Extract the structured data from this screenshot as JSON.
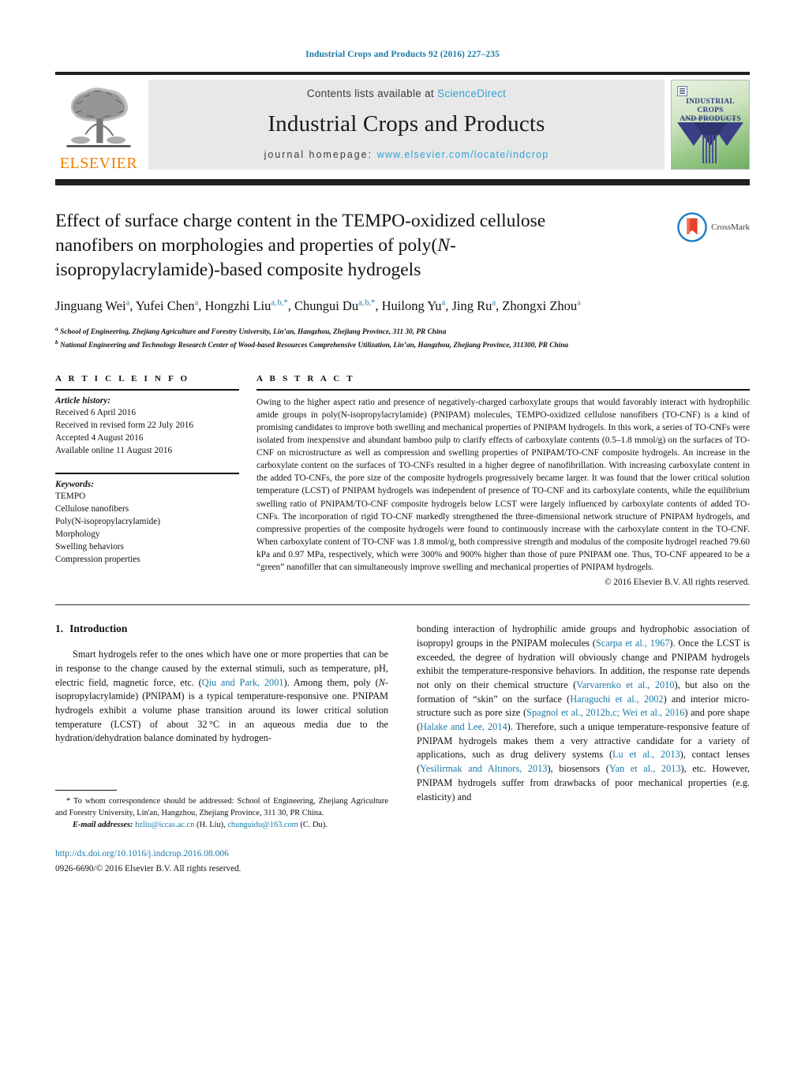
{
  "running_head": "Industrial Crops and Products 92 (2016) 227–235",
  "masthead": {
    "publisher_logo_text": "ELSEVIER",
    "contents_prefix": "Contents lists available at",
    "contents_link": "ScienceDirect",
    "journal_title": "Industrial Crops and Products",
    "homepage_prefix": "journal homepage:",
    "homepage_url": "www.elsevier.com/locate/indcrop",
    "cover_title_line1": "INDUSTRIAL CROPS",
    "cover_title_line2": "AND PRODUCTS",
    "cover_subtitle": "AN INTERNATIONAL JOURNAL"
  },
  "article": {
    "title_part1": "Effect of surface charge content in the TEMPO-oxidized cellulose nanofibers on morphologies and properties of poly(",
    "title_italic": "N",
    "title_part2": "-isopropylacrylamide)-based composite hydrogels",
    "crossmark_label": "CrossMark",
    "authors": "Jinguang Wei a, Yufei Chen a, Hongzhi Liu a, b,*, Chungui Du a, b,*, Huilong Yu a, Jing Ru a, Zhongxi Zhou a",
    "affiliation_a": "a School of Engineering, Zhejiang Agriculture and Forestry University, Lin'an, Hangzhou, Zhejiang Province, 311 30, PR China",
    "affiliation_b": "b National Engineering and Technology Research Center of Wood-based Resources Comprehensive Utilization, Lin'an, Hangzhou, Zhejiang Province, 311300, PR China"
  },
  "article_info": {
    "heading": "A R T I C L E   I N F O",
    "history_label": "Article history:",
    "history": [
      "Received 6 April 2016",
      "Received in revised form 22 July 2016",
      "Accepted 4 August 2016",
      "Available online 11 August 2016"
    ],
    "keywords_label": "Keywords:",
    "keywords": [
      "TEMPO",
      "Cellulose nanofibers",
      "Poly(N-isopropylacrylamide)",
      "Morphology",
      "Swelling behaviors",
      "Compression properties"
    ]
  },
  "abstract": {
    "heading": "A B S T R A C T",
    "text": "Owing to the higher aspect ratio and presence of negatively-charged carboxylate groups that would favorably interact with hydrophilic amide groups in poly(N-isopropylacrylamide) (PNIPAM) molecules, TEMPO-oxidized cellulose nanofibers (TO-CNF) is a kind of promising candidates to improve both swelling and mechanical properties of PNIPAM hydrogels. In this work, a series of TO-CNFs were isolated from inexpensive and abundant bamboo pulp to clarify effects of carboxylate contents (0.5–1.8 mmol/g) on the surfaces of TO-CNF on microstructure as well as compression and swelling properties of PNIPAM/TO-CNF composite hydrogels. An increase in the carboxylate content on the surfaces of TO-CNFs resulted in a higher degree of nanofibrillation. With increasing carboxylate content in the added TO-CNFs, the pore size of the composite hydrogels progressively became larger. It was found that the lower critical solution temperature (LCST) of PNIPAM hydrogels was independent of presence of TO-CNF and its carboxylate contents, while the equilibrium swelling ratio of PNIPAM/TO-CNF composite hydrogels below LCST were largely influenced by carboxylate contents of added TO-CNFs. The incorporation of rigid TO-CNF markedly strengthened the three-dimensional network structure of PNIPAM hydrogels, and compressive properties of the composite hydrogels were found to continuously increase with the carboxylate content in the TO-CNF. When carboxylate content of TO-CNF was 1.8 mmol/g, both compressive strength and modulus of the composite hydrogel reached 79.60 kPa and 0.97 MPa, respectively, which were 300% and 900% higher than those of pure PNIPAM one. Thus, TO-CNF appeared to be a “green” nanofiller that can simultaneously improve swelling and mechanical properties of PNIPAM hydrogels.",
    "copyright": "© 2016 Elsevier B.V. All rights reserved."
  },
  "introduction": {
    "number": "1.",
    "heading": "Introduction",
    "paragraph_left": "Smart hydrogels refer to the ones which have one or more properties that can be in response to the change caused by the external stimuli, such as temperature, pH, electric field, magnetic force, etc. (Qiu and Park, 2001). Among them, poly (N-isopropylacrylamide) (PNIPAM) is a typical temperature-responsive one. PNIPAM hydrogels exhibit a volume phase transition around its lower critical solution temperature (LCST) of about 32 °C in an aqueous media due to the hydration/dehydration balance dominated by hydrogen-",
    "paragraph_right": "bonding interaction of hydrophilic amide groups and hydrophobic association of isopropyl groups in the PNIPAM molecules (Scarpa et al., 1967). Once the LCST is exceeded, the degree of hydration will obviously change and PNIPAM hydrogels exhibit the temperature-responsive behaviors. In addition, the response rate depends not only on their chemical structure (Varvarenko et al., 2010), but also on the formation of “skin” on the surface (Haraguchi et al., 2002) and interior micro-structure such as pore size (Spagnol et al., 2012b,c; Wei et al., 2016) and pore shape (Halake and Lee, 2014). Therefore, such a unique temperature-responsive feature of PNIPAM hydrogels makes them a very attractive candidate for a variety of applications, such as drug delivery systems (Lu et al., 2013), contact lenses (Yesilirmak and Altınors, 2013), biosensors (Yan et al., 2013), etc. However, PNIPAM hydrogels suffer from drawbacks of poor mechanical properties (e.g. elasticity) and",
    "citations_left": [
      "Qiu and Park, 2001"
    ],
    "citations_right": [
      "Scarpa et al., 1967",
      "Varvarenko et al., 2010",
      "Haraguchi et al., 2002",
      "Spagnol et al., 2012b,c; Wei et al., 2016",
      "Halake and Lee, 2014",
      "Lu et al., 2013",
      "Yesilirmak and Altınors, 2013",
      "Yan et al., 2013"
    ]
  },
  "footnotes": {
    "correspondence": "* To whom correspondence should be addressed: School of Engineering, Zhejiang Agriculture and Forestry University, Lin'an, Hangzhou, Zhejiang Province, 311 30, PR China.",
    "email_label": "E-mail addresses:",
    "email_1": "hzliu@iccas.ac.cn",
    "email_1_who": "(H. Liu),",
    "email_2": "chunguidu@163.com",
    "email_2_who": "(C. Du).",
    "doi": "http://dx.doi.org/10.1016/j.indcrop.2016.08.006",
    "issn_line": "0926-6690/© 2016 Elsevier B.V. All rights reserved."
  },
  "colors": {
    "link_blue": "#1a7aa8",
    "sciencedirect_blue": "#2ea3d6",
    "elsevier_orange": "#f08000",
    "rule_black": "#231f20"
  }
}
